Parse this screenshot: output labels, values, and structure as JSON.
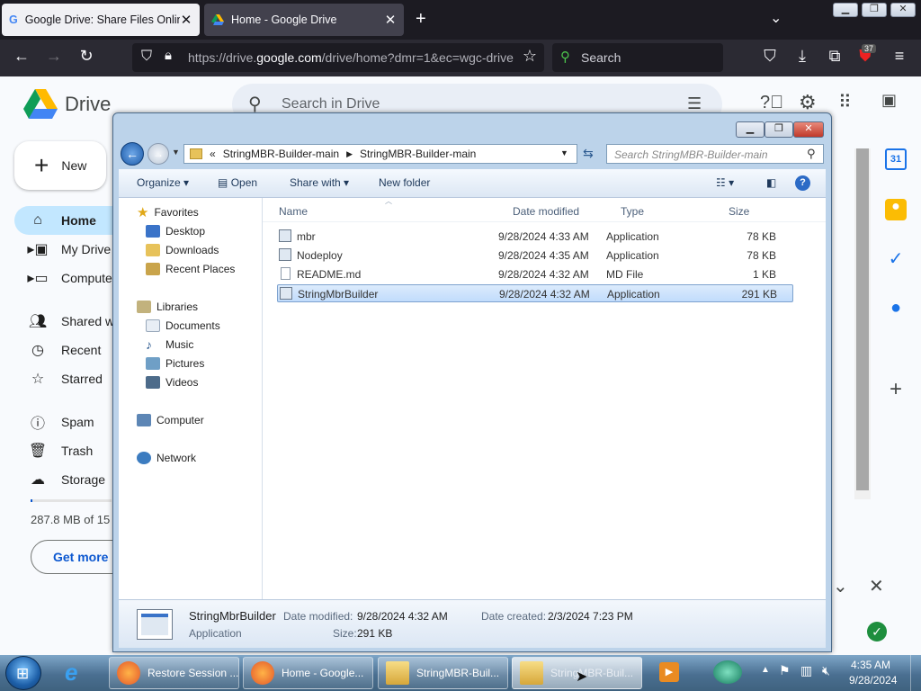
{
  "browser": {
    "tabs": [
      {
        "title": "Google Drive: Share Files Online",
        "active": false
      },
      {
        "title": "Home - Google Drive",
        "active": true
      }
    ],
    "new_tab": "+",
    "url_prefix": "https://drive.",
    "url_domain": "google.com",
    "url_path": "/drive/home?dmr=1&ec=wgc-drive",
    "search_placeholder": "Search",
    "extension_badge": "37"
  },
  "drive": {
    "logo_text": "Drive",
    "search_placeholder": "Search in Drive",
    "new_label": "New",
    "nav": [
      {
        "label": "Home",
        "icon": "home-icon",
        "active": true
      },
      {
        "label": "My Drive",
        "icon": "my-drive-icon",
        "active": false
      },
      {
        "label": "Computers",
        "icon": "computers-icon",
        "active": false
      },
      {
        "label": "Shared with me",
        "icon": "shared-icon",
        "active": false
      },
      {
        "label": "Recent",
        "icon": "recent-icon",
        "active": false
      },
      {
        "label": "Starred",
        "icon": "star-icon",
        "active": false
      },
      {
        "label": "Spam",
        "icon": "spam-icon",
        "active": false
      },
      {
        "label": "Trash",
        "icon": "trash-icon",
        "active": false
      },
      {
        "label": "Storage",
        "icon": "cloud-icon",
        "active": false
      }
    ],
    "quota_text": "287.8 MB of 15",
    "get_more": "Get more"
  },
  "explorer": {
    "breadcrumb_prefix": "«",
    "breadcrumb": [
      "StringMBR-Builder-main",
      "StringMBR-Builder-main"
    ],
    "search_placeholder": "Search StringMBR-Builder-main",
    "toolbar": {
      "organize": "Organize",
      "open": "Open",
      "share_with": "Share with",
      "new_folder": "New folder"
    },
    "nav": {
      "favorites": "Favorites",
      "favorite_items": [
        "Desktop",
        "Downloads",
        "Recent Places"
      ],
      "libraries": "Libraries",
      "library_items": [
        "Documents",
        "Music",
        "Pictures",
        "Videos"
      ],
      "computer": "Computer",
      "network": "Network"
    },
    "columns": [
      "Name",
      "Date modified",
      "Type",
      "Size"
    ],
    "files": [
      {
        "name": "mbr",
        "date": "9/28/2024 4:33 AM",
        "type": "Application",
        "size": "78 KB",
        "selected": false
      },
      {
        "name": "Nodeploy",
        "date": "9/28/2024 4:35 AM",
        "type": "Application",
        "size": "78 KB",
        "selected": false
      },
      {
        "name": "README.md",
        "date": "9/28/2024 4:32 AM",
        "type": "MD File",
        "size": "1 KB",
        "selected": false
      },
      {
        "name": "StringMbrBuilder",
        "date": "9/28/2024 4:32 AM",
        "type": "Application",
        "size": "291 KB",
        "selected": true
      }
    ],
    "details": {
      "name": "StringMbrBuilder",
      "type": "Application",
      "date_modified_label": "Date modified:",
      "date_modified": "9/28/2024 4:32 AM",
      "date_created_label": "Date created:",
      "date_created": "2/3/2024 7:23 PM",
      "size_label": "Size:",
      "size": "291 KB"
    }
  },
  "taskbar": {
    "buttons": [
      "Restore Session ...",
      "Home - Google...",
      "StringMBR-Buil...",
      "StringMBR-Buil..."
    ],
    "time": "4:35 AM",
    "date": "9/28/2024"
  }
}
